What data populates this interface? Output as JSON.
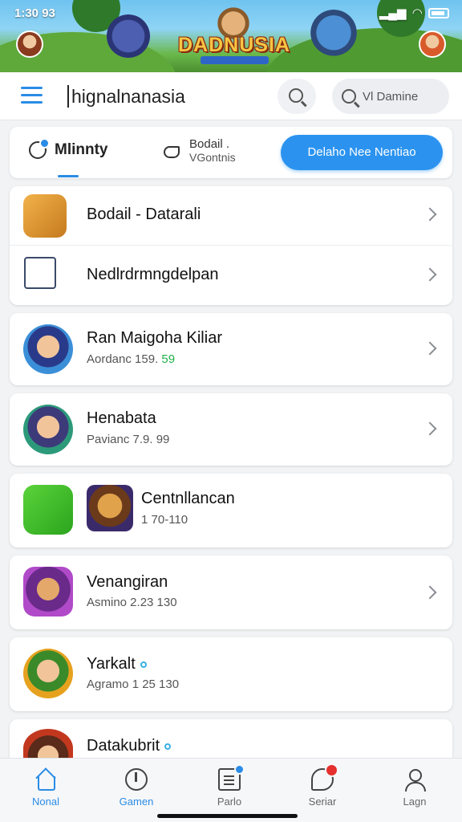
{
  "status_bar": {
    "time": "1:30 93",
    "battery": "battery-icon",
    "wifi": "wifi-icon"
  },
  "banner": {
    "logo_text": "DADNUSIA"
  },
  "header": {
    "title": "hignalnanasia",
    "search_placeholder": "Vl Damine"
  },
  "tabs": {
    "tab1_label": "Mlinnty",
    "tab2_line1": "Bodail .",
    "tab2_line2": "VGontnis",
    "cta_label": "Delaho Nee Nentiao"
  },
  "list_groups": [
    {
      "rows": [
        {
          "title": "Bodail - Datarali",
          "subtitle": "",
          "icon": "puzzle-cube-icon",
          "chevron": true
        },
        {
          "title": "Nedlrdrmngdelpan",
          "subtitle": "",
          "icon": "network-icon",
          "chevron": true
        }
      ]
    },
    {
      "rows": [
        {
          "title": "Ran Maigoha Kiliar",
          "subtitle": "Aordanc 159.",
          "subtitle_highlight": "59",
          "icon": "hero-avatar-icon",
          "chevron": true
        }
      ]
    },
    {
      "rows": [
        {
          "title": "Henabata",
          "subtitle": "Pavianc 7.9. 99",
          "icon": "knight-avatar-icon",
          "chevron": true
        }
      ]
    },
    {
      "rows": [
        {
          "title": "Centnllancan",
          "subtitle": "1 70-110",
          "icon": "game-badge-icon",
          "icon2": "warrior-avatar-icon",
          "chevron": false
        }
      ]
    },
    {
      "rows": [
        {
          "title": "Venangiran",
          "subtitle": "Asmino 2.23 130",
          "icon": "wizard-avatar-icon",
          "chevron": true
        }
      ]
    },
    {
      "rows": [
        {
          "title": "Yarkalt",
          "subtitle": "Agramo 1 25 130",
          "icon": "chef-avatar-icon",
          "chevron": false,
          "dot": true
        }
      ]
    },
    {
      "rows": [
        {
          "title": "Datakubrit",
          "subtitle": "",
          "icon": "villain-avatar-icon",
          "chevron": false,
          "dot": true
        }
      ]
    }
  ],
  "bottom_nav": [
    {
      "label": "Nonal",
      "icon": "home-icon",
      "active": true
    },
    {
      "label": "Gamen",
      "icon": "games-icon",
      "active": false
    },
    {
      "label": "Parlo",
      "icon": "news-icon",
      "active": false
    },
    {
      "label": "Seriar",
      "icon": "chat-icon",
      "active": false
    },
    {
      "label": "Lagn",
      "icon": "user-icon",
      "active": false
    }
  ],
  "colors": {
    "accent": "#2a8ce6",
    "cta": "#2b93ef",
    "highlight": "#22b24c",
    "badge": "#e5302e"
  }
}
